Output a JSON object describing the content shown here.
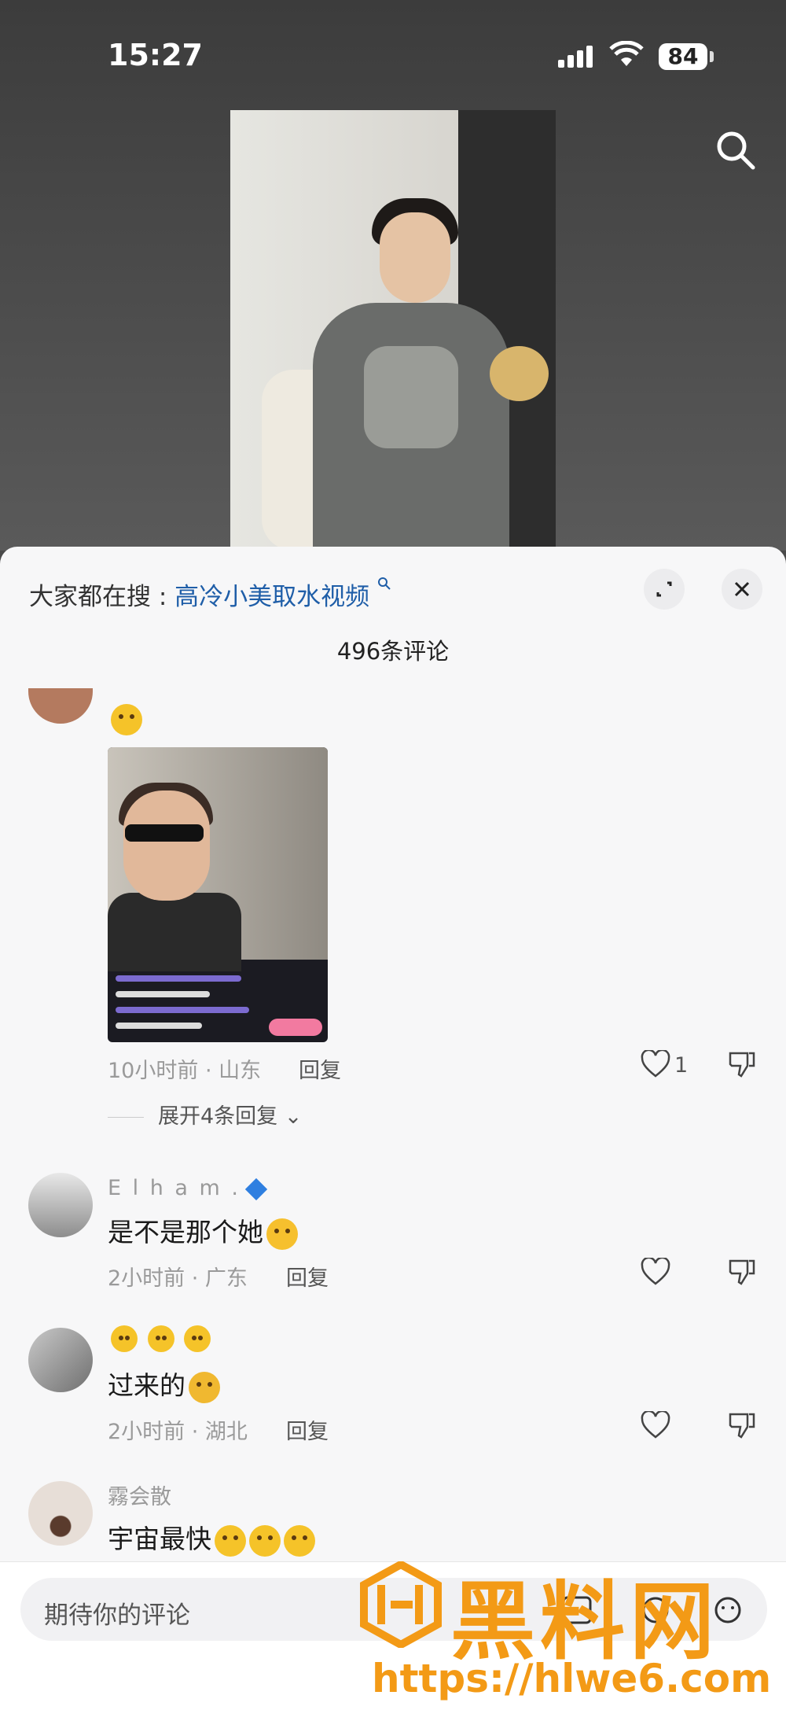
{
  "status": {
    "time": "15:27",
    "battery": "84"
  },
  "sheet": {
    "trend_prefix": "大家都在搜 :",
    "trend_link": "高冷小美取水视频",
    "comment_count": "496条评论"
  },
  "comments": [
    {
      "emoji": "grinning",
      "time_location": "10小时前 · 山东",
      "reply": "回复",
      "likes": "1",
      "expand": "展开4条回复"
    },
    {
      "username": "E l h a m .",
      "text": "是不是那个她",
      "time_location": "2小时前 · 广东",
      "reply": "回复"
    },
    {
      "username_emojis": "smiling ×3",
      "text": "过来的",
      "time_location": "2小时前 · 湖北",
      "reply": "回复"
    },
    {
      "username": "霧会散",
      "text": "宇宙最快"
    }
  ],
  "input": {
    "placeholder": "期待你的评论"
  },
  "watermark": {
    "brand": "黑料网",
    "url": "https://hlwe6.com"
  }
}
